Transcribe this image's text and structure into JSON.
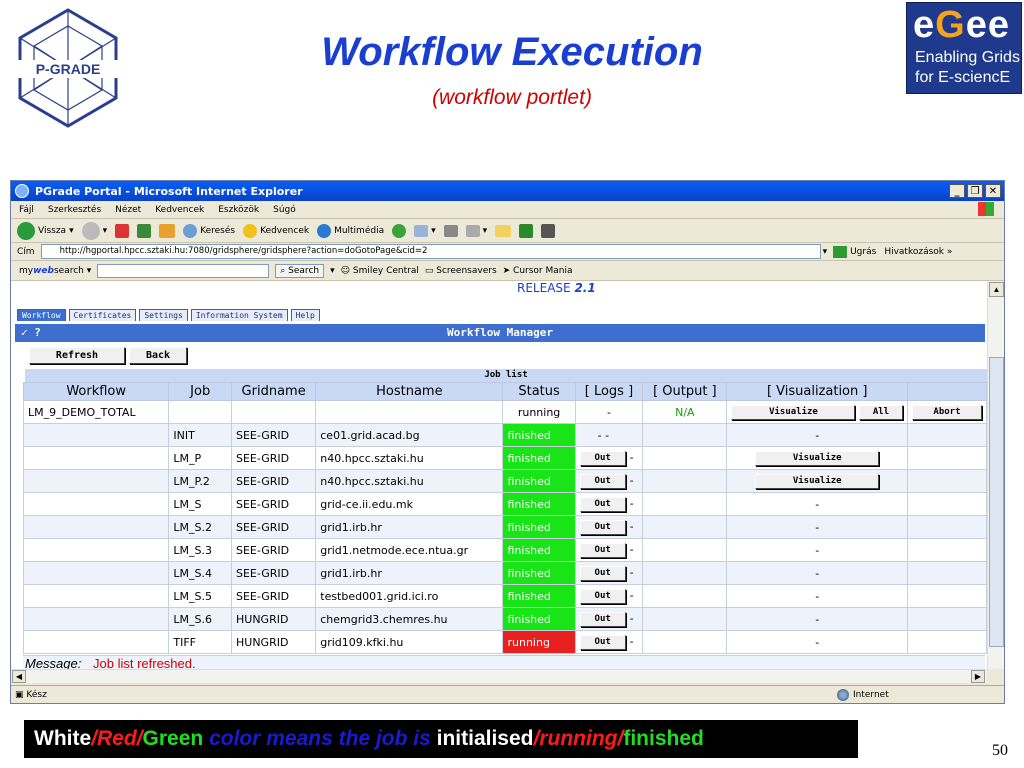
{
  "slide": {
    "title": "Workflow Execution",
    "subtitle": "(workflow portlet)",
    "page_number": "50",
    "pgrade_logo_text": "P-GRADE",
    "egee_logo": {
      "brand": "eGee",
      "line1": "Enabling Grids",
      "line2": "for E-sciencE"
    },
    "caption": {
      "white": "White",
      "sep1": "/",
      "red": "Red",
      "sep2": "/",
      "green": "Green",
      "middle": " color means the job is ",
      "initialised": "initialised",
      "sep3": "/",
      "running": "running",
      "sep4": "/",
      "finished": "finished"
    }
  },
  "browser": {
    "title": "PGrade Portal - Microsoft Internet Explorer",
    "menu": [
      "Fájl",
      "Szerkesztés",
      "Nézet",
      "Kedvencek",
      "Eszközök",
      "Súgó"
    ],
    "toolbar": {
      "back": "Vissza",
      "search": "Keresés",
      "favorites": "Kedvencek",
      "media": "Multimédia"
    },
    "address_label": "Cím",
    "address": "http://hgportal.hpcc.sztaki.hu:7080/gridsphere/gridsphere?action=doGotoPage&cid=2",
    "go": "Ugrás",
    "links": "Hivatkozások",
    "searchbar": {
      "brand_my": "my",
      "brand_web": "web",
      "brand_search": "search",
      "search_btn": "Search",
      "smiley": "Smiley Central",
      "screensavers": "Screensavers",
      "cursor": "Cursor Mania"
    },
    "status": "Kész",
    "zone": "Internet"
  },
  "portal": {
    "release_label": "RELEASE",
    "release_version": "2.1",
    "tabs": [
      "Workflow",
      "Certificates",
      "Settings",
      "Information System",
      "Help"
    ],
    "manager_title": "Workflow Manager",
    "manager_icons": "✓ ?",
    "refresh": "Refresh",
    "back": "Back",
    "joblist_title": "Job list",
    "columns": [
      "Workflow",
      "Job",
      "Gridname",
      "Hostname",
      "Status",
      "[ Logs ]",
      "[ Output ]",
      "[ Visualization ]",
      ""
    ],
    "workflow_row": {
      "workflow": "LM_9_DEMO_TOTAL",
      "status": "running",
      "logs": "-",
      "output": "N/A",
      "visualize": "Visualize",
      "all": "All",
      "abort": "Abort"
    },
    "jobs": [
      {
        "job": "INIT",
        "grid": "SEE-GRID",
        "host": "ce01.grid.acad.bg",
        "status": "finished",
        "state": "finished",
        "logs": "- -",
        "out": "",
        "dash": "",
        "vis": "-"
      },
      {
        "job": "LM_P",
        "grid": "SEE-GRID",
        "host": "n40.hpcc.sztaki.hu",
        "status": "finished",
        "state": "finished",
        "logs": "",
        "out": "Out",
        "dash": "-",
        "vis": "Visualize"
      },
      {
        "job": "LM_P.2",
        "grid": "SEE-GRID",
        "host": "n40.hpcc.sztaki.hu",
        "status": "finished",
        "state": "finished",
        "logs": "",
        "out": "Out",
        "dash": "-",
        "vis": "Visualize"
      },
      {
        "job": "LM_S",
        "grid": "SEE-GRID",
        "host": "grid-ce.ii.edu.mk",
        "status": "finished",
        "state": "finished",
        "logs": "",
        "out": "Out",
        "dash": "-",
        "vis": "-"
      },
      {
        "job": "LM_S.2",
        "grid": "SEE-GRID",
        "host": "grid1.irb.hr",
        "status": "finished",
        "state": "finished",
        "logs": "",
        "out": "Out",
        "dash": "-",
        "vis": "-"
      },
      {
        "job": "LM_S.3",
        "grid": "SEE-GRID",
        "host": "grid1.netmode.ece.ntua.gr",
        "status": "finished",
        "state": "finished",
        "logs": "",
        "out": "Out",
        "dash": "-",
        "vis": "-"
      },
      {
        "job": "LM_S.4",
        "grid": "SEE-GRID",
        "host": "grid1.irb.hr",
        "status": "finished",
        "state": "finished",
        "logs": "",
        "out": "Out",
        "dash": "-",
        "vis": "-"
      },
      {
        "job": "LM_S.5",
        "grid": "SEE-GRID",
        "host": "testbed001.grid.ici.ro",
        "status": "finished",
        "state": "finished",
        "logs": "",
        "out": "Out",
        "dash": "-",
        "vis": "-"
      },
      {
        "job": "LM_S.6",
        "grid": "HUNGRID",
        "host": "chemgrid3.chemres.hu",
        "status": "finished",
        "state": "finished",
        "logs": "",
        "out": "Out",
        "dash": "-",
        "vis": "-"
      },
      {
        "job": "TIFF",
        "grid": "HUNGRID",
        "host": "grid109.kfki.hu",
        "status": "running",
        "state": "running",
        "logs": "",
        "out": "Out",
        "dash": "-",
        "vis": "-"
      }
    ],
    "message_label": "Message:",
    "message_text": "Job list refreshed."
  },
  "colors": {
    "finished": "#18e418",
    "running": "#e82020",
    "header": "#3e6fcf",
    "title": "#1a3fd0"
  }
}
